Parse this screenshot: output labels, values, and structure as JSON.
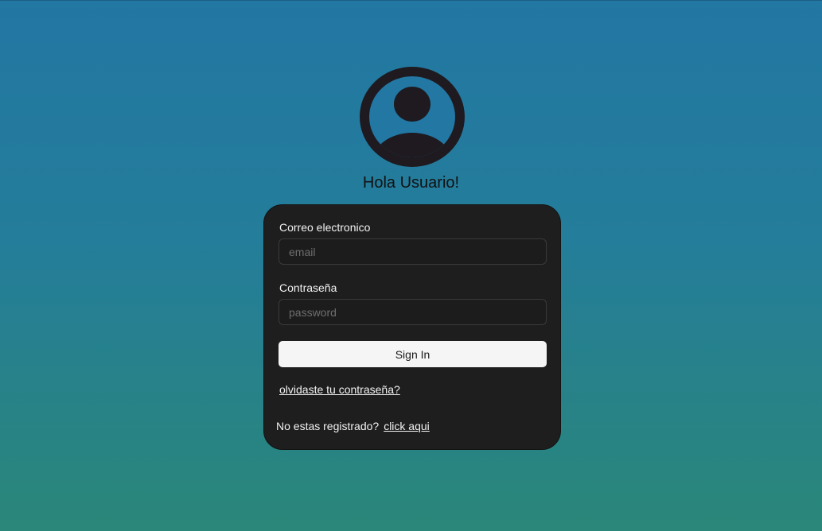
{
  "greeting": "Hola Usuario!",
  "avatar": {
    "icon": "user-circle-icon",
    "color": "#1e1a20"
  },
  "form": {
    "email_label": "Correo electronico",
    "email_placeholder": "email",
    "password_label": "Contraseña",
    "password_placeholder": "password",
    "signin_label": "Sign In",
    "forgot_link": "olvidaste tu contraseña?",
    "register_prompt": "No estas registrado?",
    "register_link": "click aqui"
  },
  "colors": {
    "background_top": "#2277a3",
    "background_bottom": "#2a8779",
    "card": "#1e1e1e",
    "button": "#f5f5f5"
  }
}
